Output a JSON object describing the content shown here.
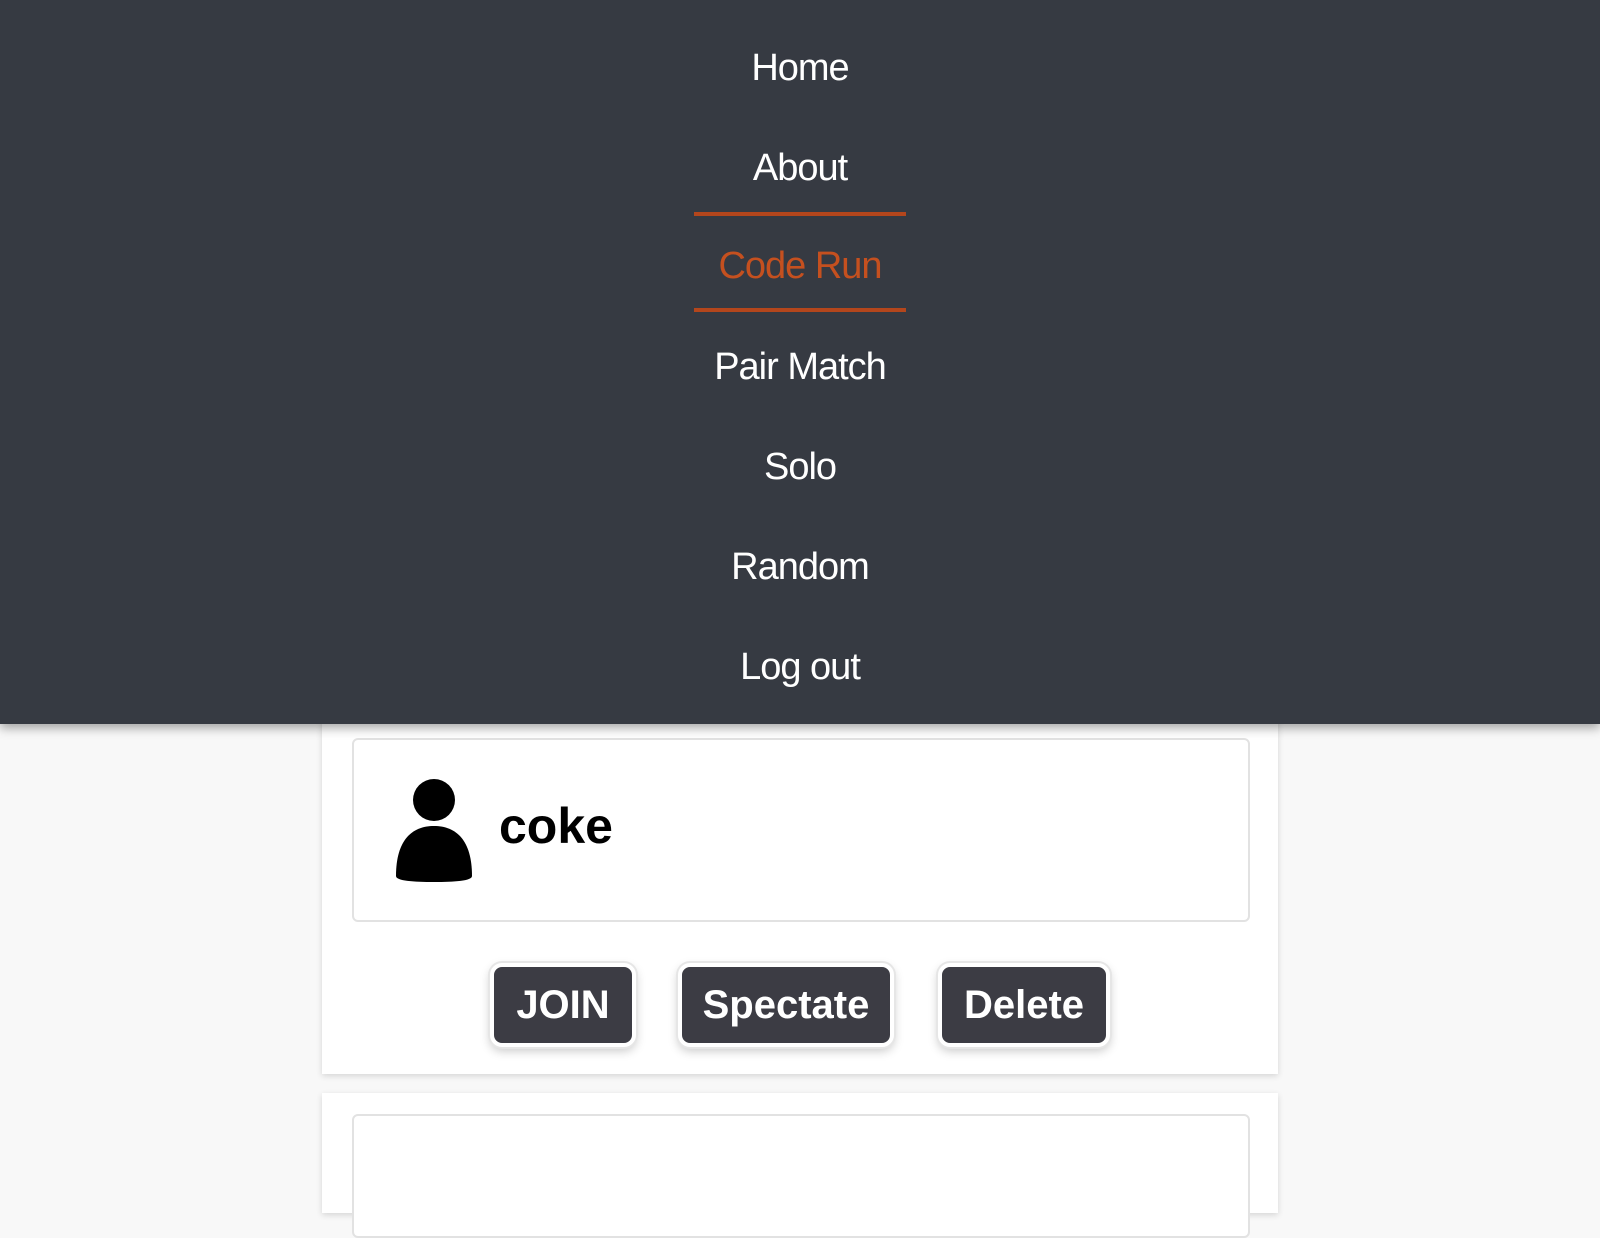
{
  "nav": {
    "items": [
      {
        "label": "Home",
        "active": false
      },
      {
        "label": "About",
        "active": false
      },
      {
        "label": "Code Run",
        "active": true
      },
      {
        "label": "Pair Match",
        "active": false
      },
      {
        "label": "Solo",
        "active": false
      },
      {
        "label": "Random",
        "active": false
      },
      {
        "label": "Log out",
        "active": false
      }
    ]
  },
  "rooms": [
    {
      "host": "coke",
      "buttons": {
        "join": "JOIN",
        "spectate": "Spectate",
        "delete": "Delete"
      }
    }
  ],
  "colors": {
    "nav_background": "#363a42",
    "active_accent": "#c5501f",
    "button_background": "#3c3c44",
    "page_background": "#f8f8f8"
  },
  "icons": {
    "user": "user-icon"
  }
}
